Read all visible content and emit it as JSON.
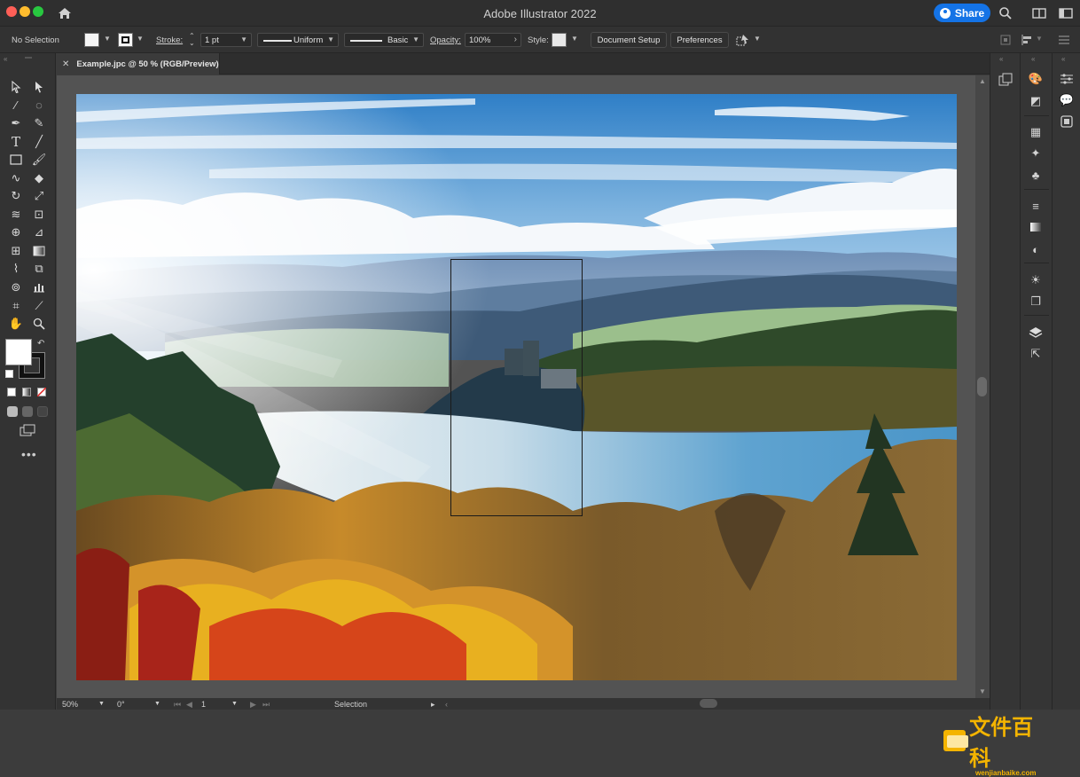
{
  "window": {
    "title": "Adobe Illustrator 2022",
    "share_label": "Share"
  },
  "control_bar": {
    "selection_status": "No Selection",
    "stroke_label": "Stroke:",
    "stroke_weight": "1 pt",
    "stroke_profile": "Uniform",
    "brush_definition": "Basic",
    "opacity_label": "Opacity:",
    "opacity_value": "100%",
    "style_label": "Style:",
    "document_setup_label": "Document Setup",
    "preferences_label": "Preferences"
  },
  "document": {
    "tab_label": "Example.jpc @ 50 % (RGB/Preview)"
  },
  "status_bar": {
    "zoom": "50%",
    "rotation": "0°",
    "artboard_number": "1",
    "current_tool": "Selection"
  },
  "watermark": {
    "brand_cn": "文件百科",
    "url": "wenjianbaike.com"
  },
  "colors": {
    "accent": "#1473e6",
    "close": "#ff5f57",
    "minimize": "#febc2e",
    "maximize": "#28c840",
    "chrome_bg": "#323232",
    "canvas_bg": "#535353"
  }
}
